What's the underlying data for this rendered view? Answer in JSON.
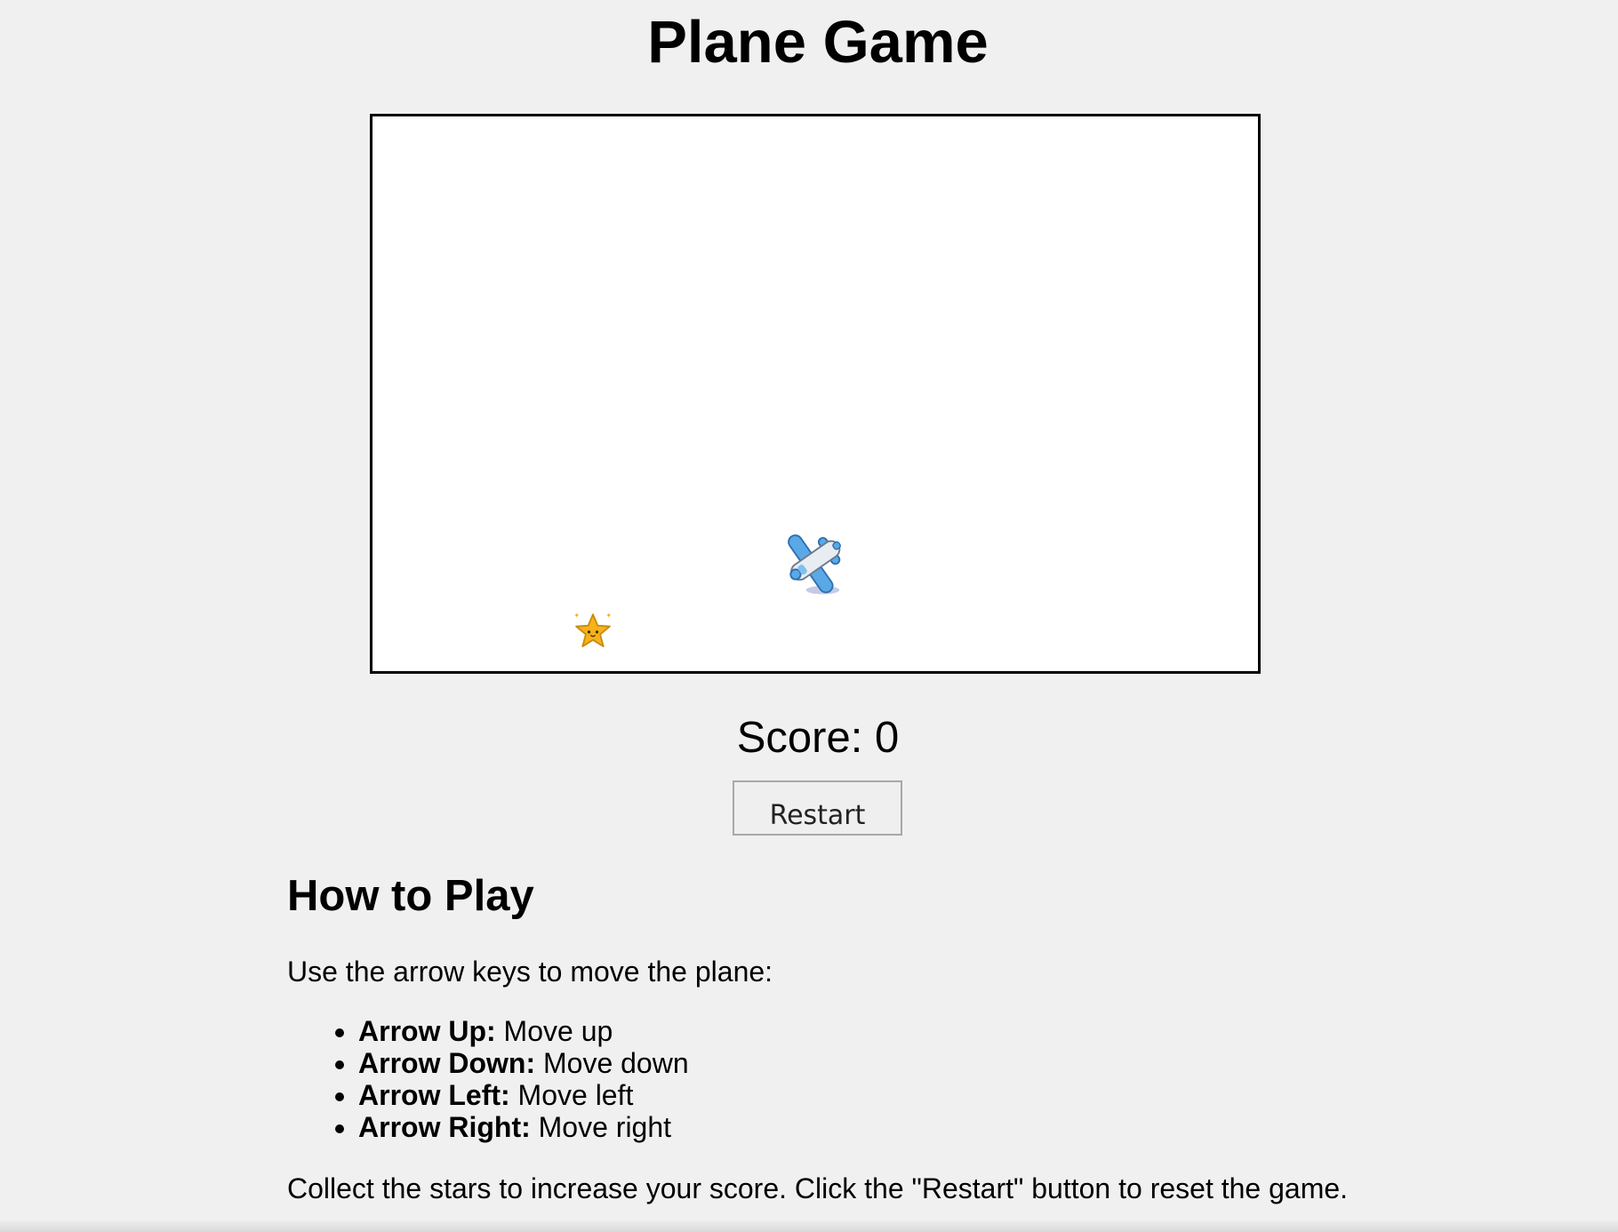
{
  "page": {
    "title": "Plane Game"
  },
  "game": {
    "score_label": "Score: 0",
    "sprites": {
      "player": "airplane-icon",
      "collectible": "star-icon"
    }
  },
  "controls": {
    "restart_label": "Restart"
  },
  "instructions": {
    "heading": "How to Play",
    "intro": "Use the arrow keys to move the plane:",
    "items": [
      {
        "key": "Arrow Up:",
        "action": " Move up"
      },
      {
        "key": "Arrow Down:",
        "action": " Move down"
      },
      {
        "key": "Arrow Left:",
        "action": " Move left"
      },
      {
        "key": "Arrow Right:",
        "action": " Move right"
      }
    ],
    "footer": "Collect the stars to increase your score. Click the \"Restart\" button to reset the game."
  },
  "colors": {
    "background": "#f0f0f0",
    "canvas": "#ffffff",
    "plane_body": "#5aa9e6",
    "plane_fuselage": "#e8edf2",
    "star": "#f6b21b"
  }
}
